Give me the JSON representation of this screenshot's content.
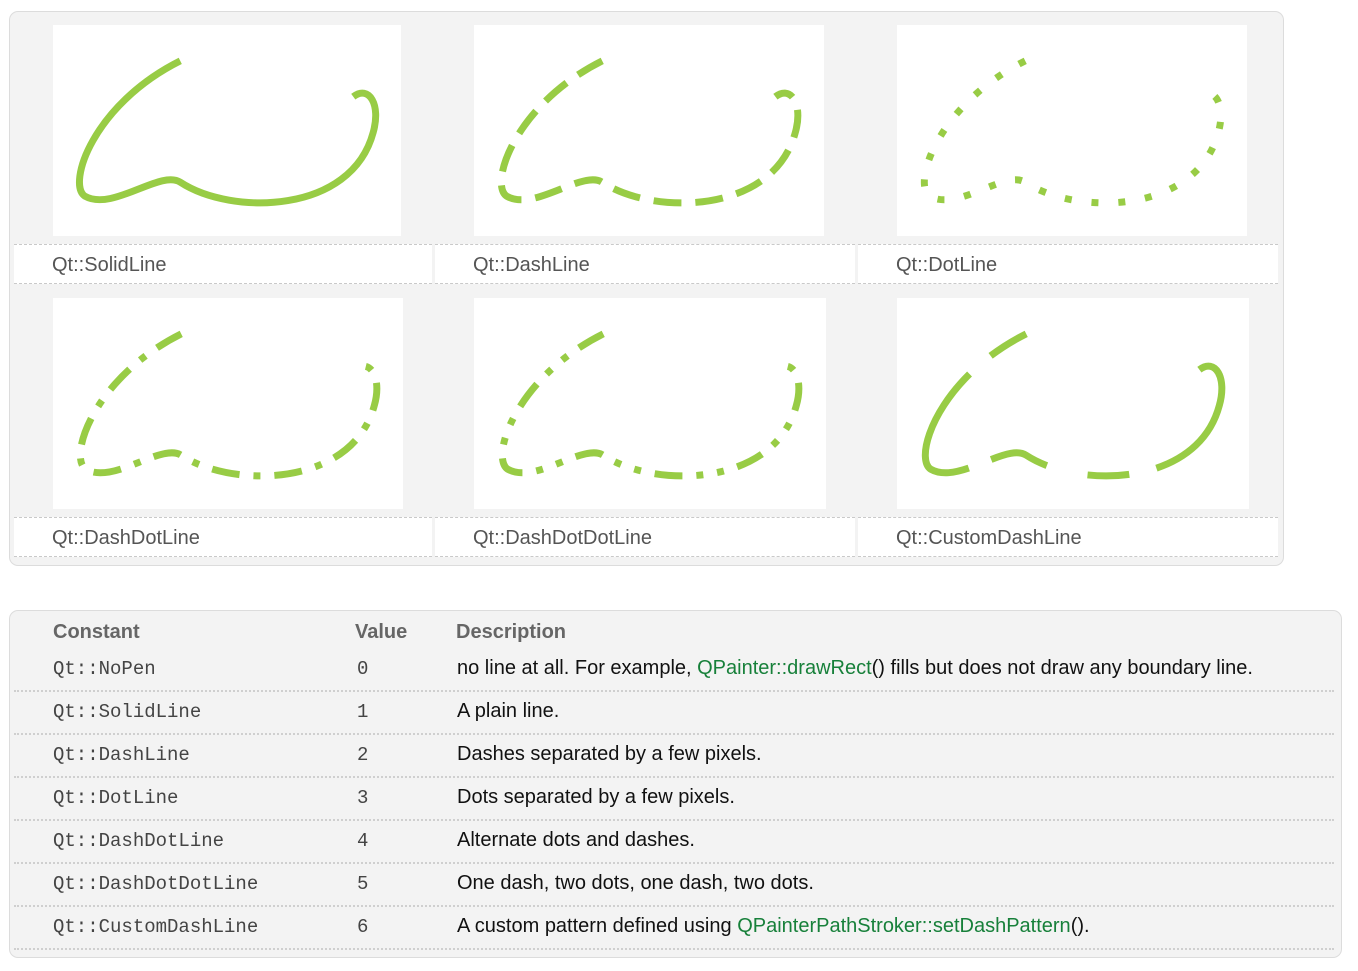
{
  "colors": {
    "stroke": "#98cc45",
    "link": "#17803a"
  },
  "gallery": {
    "items": [
      {
        "caption": "Qt::SolidLine"
      },
      {
        "caption": "Qt::DashLine"
      },
      {
        "caption": "Qt::DotLine"
      },
      {
        "caption": "Qt::DashDotLine"
      },
      {
        "caption": "Qt::DashDotDotLine"
      },
      {
        "caption": "Qt::CustomDashLine"
      }
    ]
  },
  "table": {
    "headers": {
      "constant": "Constant",
      "value": "Value",
      "description": "Description"
    },
    "rows": [
      {
        "constant": "Qt::NoPen",
        "value": "0",
        "desc_before": "no line at all. For example, ",
        "desc_link": "QPainter::drawRect",
        "desc_after": "() fills but does not draw any boundary line."
      },
      {
        "constant": "Qt::SolidLine",
        "value": "1",
        "desc_before": "A plain line.",
        "desc_link": "",
        "desc_after": ""
      },
      {
        "constant": "Qt::DashLine",
        "value": "2",
        "desc_before": "Dashes separated by a few pixels.",
        "desc_link": "",
        "desc_after": ""
      },
      {
        "constant": "Qt::DotLine",
        "value": "3",
        "desc_before": "Dots separated by a few pixels.",
        "desc_link": "",
        "desc_after": ""
      },
      {
        "constant": "Qt::DashDotLine",
        "value": "4",
        "desc_before": "Alternate dots and dashes.",
        "desc_link": "",
        "desc_after": ""
      },
      {
        "constant": "Qt::DashDotDotLine",
        "value": "5",
        "desc_before": "One dash, two dots, one dash, two dots.",
        "desc_link": "",
        "desc_after": ""
      },
      {
        "constant": "Qt::CustomDashLine",
        "value": "6",
        "desc_before": "A custom pattern defined using ",
        "desc_link": "QPainterPathStroker::setDashPattern",
        "desc_after": "()."
      }
    ]
  }
}
